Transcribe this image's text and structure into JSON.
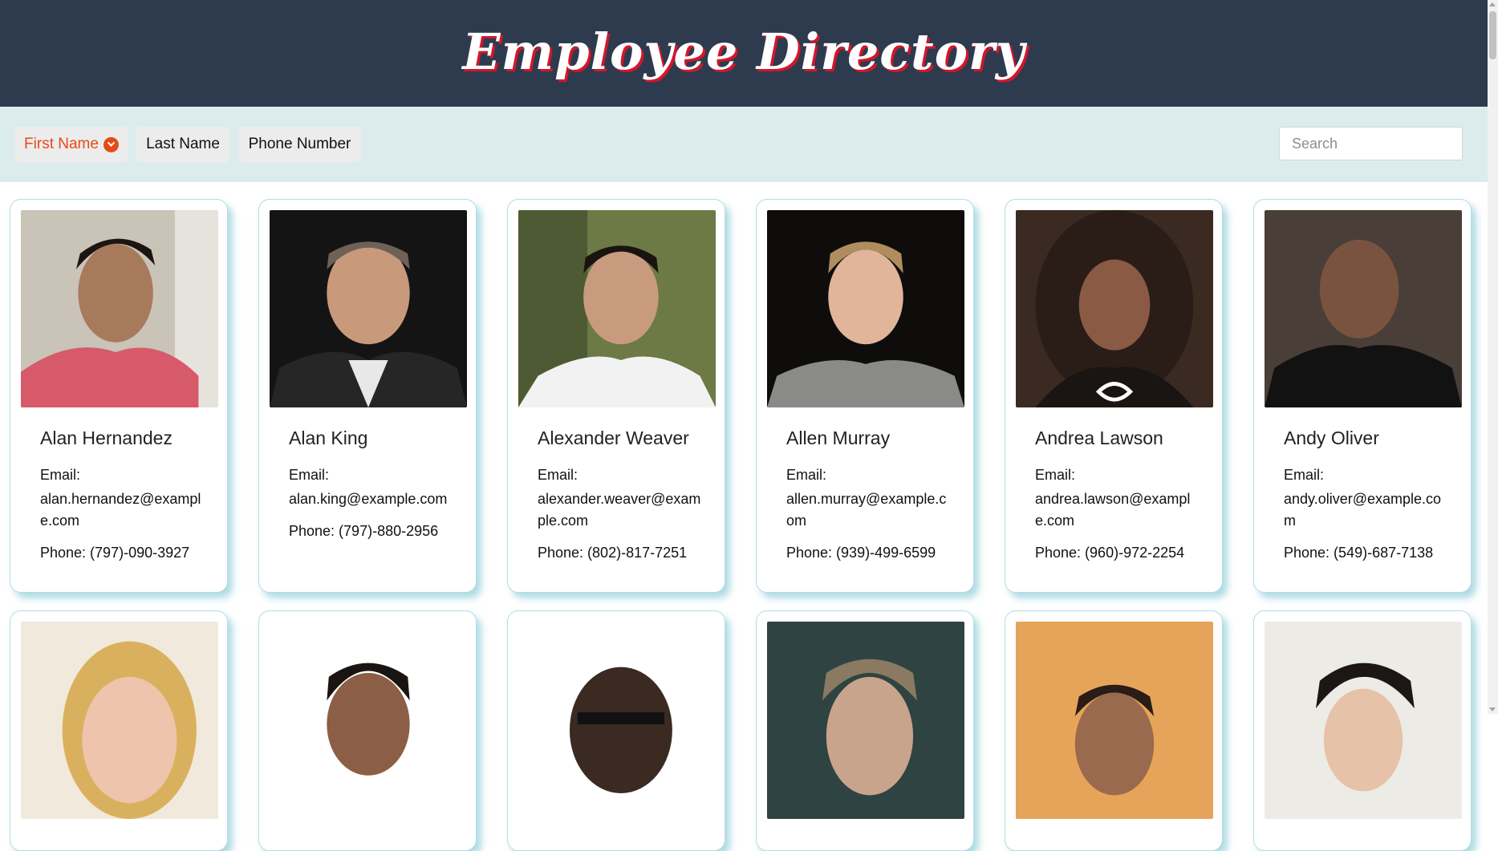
{
  "header": {
    "title": "Employee Directory"
  },
  "toolbar": {
    "sort_first_name": "First Name",
    "sort_last_name": "Last Name",
    "sort_phone": "Phone Number",
    "search_placeholder": "Search",
    "active_sort": "first_name"
  },
  "colors": {
    "header_bg": "#2e3b4e",
    "title_shadow": "#d4162a",
    "toolbar_bg": "#dcecec",
    "accent": "#e64a19",
    "card_border": "#b3dde4"
  },
  "employees": [
    {
      "name": "Alan Hernandez",
      "email_label": "Email:",
      "email": "alan.hernandez@example.com",
      "phone": "Phone: (797)-090-3927"
    },
    {
      "name": "Alan King",
      "email_label": "Email:",
      "email": "alan.king@example.com",
      "phone": "Phone: (797)-880-2956"
    },
    {
      "name": "Alexander Weaver",
      "email_label": "Email:",
      "email": "alexander.weaver@example.com",
      "phone": "Phone: (802)-817-7251"
    },
    {
      "name": "Allen Murray",
      "email_label": "Email:",
      "email": "allen.murray@example.com",
      "phone": "Phone: (939)-499-6599"
    },
    {
      "name": "Andrea Lawson",
      "email_label": "Email:",
      "email": "andrea.lawson@example.com",
      "phone": "Phone: (960)-972-2254"
    },
    {
      "name": "Andy Oliver",
      "email_label": "Email:",
      "email": "andy.oliver@example.com",
      "phone": "Phone: (549)-687-7138"
    }
  ]
}
